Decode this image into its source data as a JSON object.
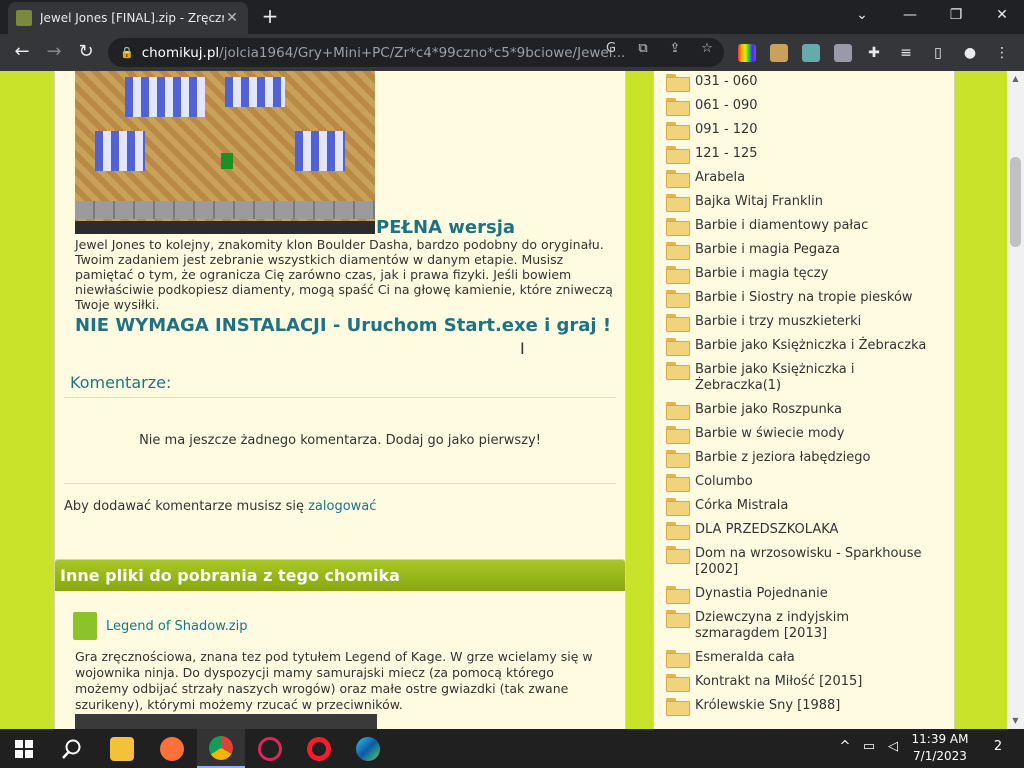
{
  "browser": {
    "tab_title": "Jewel Jones [FINAL].zip - Zręczno",
    "tab_close": "✕",
    "new_tab": "+",
    "window_controls": [
      "⌄",
      "—",
      "❐",
      "✕"
    ],
    "url_host": "chomikuj.pl",
    "url_path": "/jolcia1964/Gry+Mini+PC/Zr*c4*99czno*c5*9bciowe/Jewel..."
  },
  "content": {
    "full_version": "PEŁNA wersja",
    "description": "Jewel Jones to kolejny, znakomity klon Boulder Dasha, bardzo podobny do oryginału. Twoim zadaniem jest zebranie wszystkich diamentów w danym etapie. Musisz pamiętać o tym, że ogranicza Cię zarówno czas, jak i prawa fizyki. Jeśli bowiem niewłaściwie podkopiesz diamenty, mogą spaść Ci na głowę kamienie, które zniweczą Twoje wysiłki.",
    "no_install": "NIE WYMAGA INSTALACJI - Uruchom Start.exe i graj !",
    "comments_title": "Komentarze:",
    "no_comments": "Nie ma jeszcze żadnego komentarza. Dodaj go jako pierwszy!",
    "login_prefix": "Aby dodawać komentarze musisz się",
    "login_link": "zalogować",
    "other_files_title": "Inne pliki do pobrania z tego chomika",
    "other_file_name": "Legend of Shadow.zip",
    "other_file_desc": "Gra zręcznościowa, znana tez pod tytułem Legend of Kage. W grze wcielamy się w wojownika ninja. Do dyspozycji mamy samurajski miecz (za pomocą którego możemy odbijać strzały naszych wrogów) oraz małe ostre gwiazdki (tak zwane szurikeny), którymi możemy rzucać w przeciwników."
  },
  "folders": [
    "031 - 060",
    "061 - 090",
    "091 - 120",
    "121 - 125",
    "Arabela",
    "Bajka Witaj Franklin",
    "Barbie i diamentowy pałac",
    "Barbie i magia Pegaza",
    "Barbie i magia tęczy",
    "Barbie i Siostry na tropie piesków",
    "Barbie i trzy muszkieterki",
    "Barbie jako Księżniczka i Żebraczka",
    "Barbie jako Księżniczka i Żebraczka(1)",
    "Barbie jako Roszpunka",
    "Barbie w świecie mody",
    "Barbie z jeziora łabędziego",
    "Columbo",
    "Córka Mistrala",
    "DLA PRZEDSZKOLAKA",
    "Dom na wrzosowisku - Sparkhouse [2002]",
    "Dynastia Pojednanie",
    "Dziewczyna z indyjskim szmaragdem [2013]",
    "Esmeralda cała",
    "Kontrakt na Miłość [2015]",
    "Królewskie Sny [1988]"
  ],
  "taskbar": {
    "time": "11:39 AM",
    "date": "7/1/2023",
    "notifications": "2"
  },
  "colors": {
    "accent": "#1d7385",
    "page_bg": "#c8e32a",
    "panel_bg": "#fffbe0"
  }
}
